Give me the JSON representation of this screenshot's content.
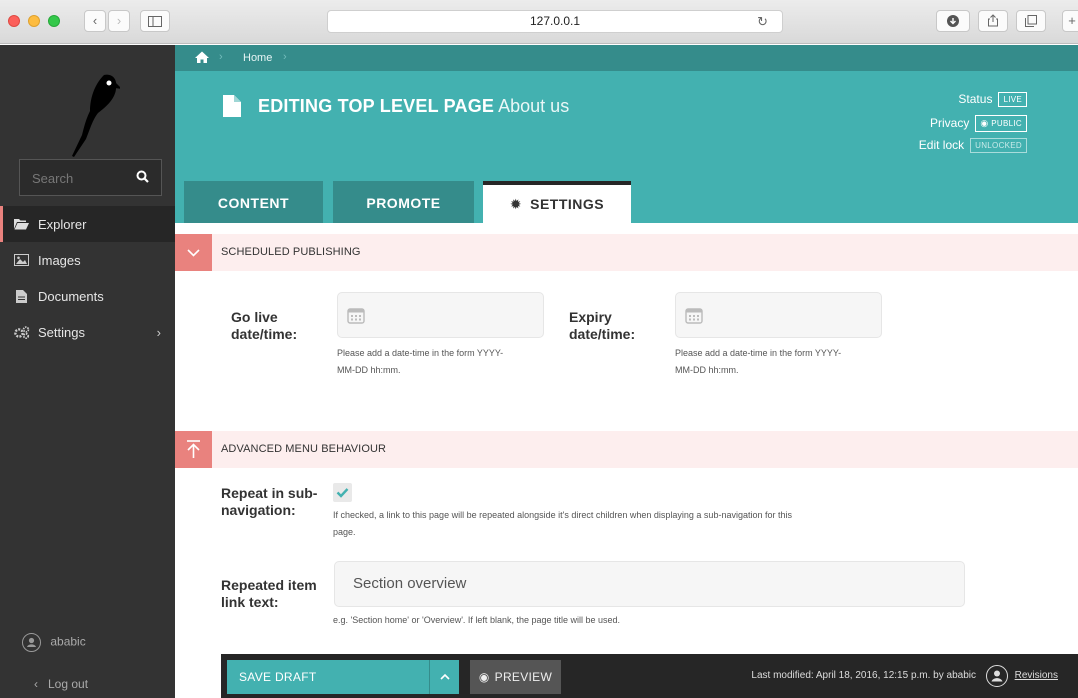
{
  "browser": {
    "url": "127.0.0.1"
  },
  "sidebar": {
    "search_placeholder": "Search",
    "items": [
      {
        "label": "Explorer",
        "icon": "folder-open-icon",
        "active": true
      },
      {
        "label": "Images",
        "icon": "image-icon"
      },
      {
        "label": "Documents",
        "icon": "document-icon"
      },
      {
        "label": "Settings",
        "icon": "cogs-icon",
        "has_submenu": true
      }
    ],
    "user": "ababic",
    "logout": "Log out"
  },
  "header": {
    "breadcrumb": [
      "Home"
    ],
    "title_action": "EDITING TOP LEVEL PAGE",
    "title_page": "About us",
    "status_label": "Status",
    "status_value": "LIVE",
    "privacy_label": "Privacy",
    "privacy_value": "PUBLIC",
    "lock_label": "Edit lock",
    "lock_value": "UNLOCKED",
    "tabs": [
      {
        "label": "CONTENT"
      },
      {
        "label": "PROMOTE"
      },
      {
        "label": "SETTINGS",
        "active": true
      }
    ]
  },
  "scheduled": {
    "title": "SCHEDULED PUBLISHING",
    "go_live_label_1": "Go live",
    "go_live_label_2": "date/time:",
    "expiry_label_1": "Expiry",
    "expiry_label_2": "date/time:",
    "help_1": "Please add a date-time in the form YYYY-",
    "help_2": "MM-DD hh:mm."
  },
  "advanced": {
    "title": "ADVANCED MENU BEHAVIOUR",
    "repeat_label_1": "Repeat in sub-",
    "repeat_label_2": "navigation:",
    "repeat_checked": true,
    "repeat_help_1": "If checked, a link to this page will be repeated alongside it's direct children when displaying a sub-navigation for this",
    "repeat_help_2": "page.",
    "link_text_label_1": "Repeated item",
    "link_text_label_2": "link text:",
    "link_text_value": "Section overview",
    "link_text_help": "e.g. 'Section home' or 'Overview'. If left blank, the page title will be used."
  },
  "footer": {
    "save_label": "SAVE DRAFT",
    "preview_label": "PREVIEW",
    "last_modified": "Last modified: April 18, 2016, 12:15 p.m. by ababic",
    "revisions": "Revisions"
  },
  "colors": {
    "teal": "#43b1b0",
    "teal_dark": "#358c8b",
    "salmon": "#e9827e",
    "sidebar": "#333333"
  }
}
